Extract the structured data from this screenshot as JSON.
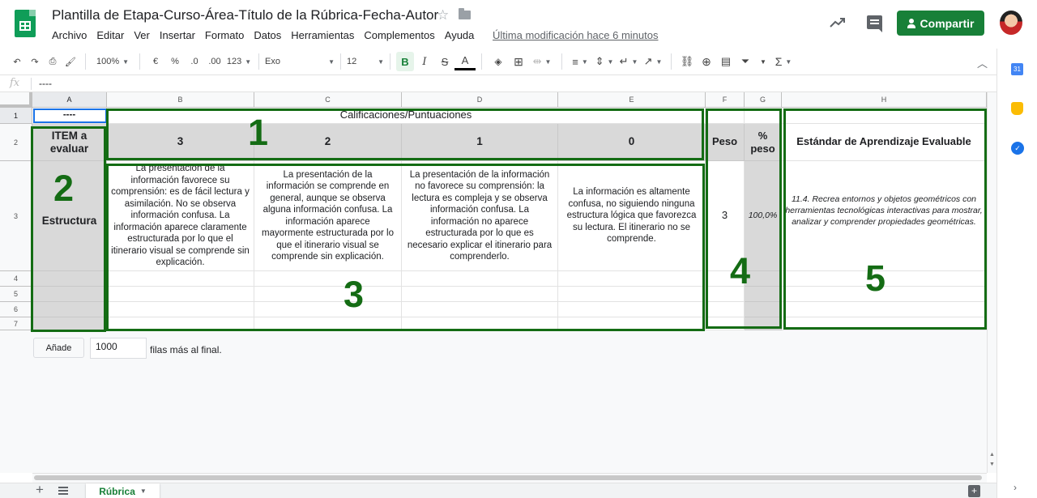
{
  "doc": {
    "title": "Plantilla de Etapa-Curso-Área-Título de la Rúbrica-Fecha-Autor",
    "last_edit": "Última modificación hace 6 minutos",
    "share_label": "Compartir"
  },
  "menu": [
    "Archivo",
    "Editar",
    "Ver",
    "Insertar",
    "Formato",
    "Datos",
    "Herramientas",
    "Complementos",
    "Ayuda"
  ],
  "toolbar": {
    "zoom": "100%",
    "currency": "€",
    "percent": "%",
    "dec_decrease": ".0",
    "dec_increase": ".00",
    "more_formats": "123",
    "font": "Exo",
    "font_size": "12",
    "bold": "B",
    "italic": "I",
    "strike": "S",
    "text_color": "A"
  },
  "formula_bar": {
    "fx": "fx",
    "value": "----"
  },
  "columns": [
    "A",
    "B",
    "C",
    "D",
    "E",
    "F",
    "G",
    "H"
  ],
  "rows": [
    "1",
    "2",
    "3",
    "4",
    "5",
    "6",
    "7"
  ],
  "cells": {
    "a1": "----",
    "header_span": "Calificaciones/Puntuaciones",
    "a2": "ITEM  a evaluar",
    "score_3": "3",
    "score_2": "2",
    "score_1": "1",
    "score_0": "0",
    "f2": "Peso",
    "g2": "% peso",
    "h2": "Estándar de Aprendizaje Evaluable",
    "a3": "Estructura",
    "b3": "La presentación de la información favorece su comprensión: es de fácil lectura y asimilación. No se observa información confusa. La información aparece claramente estructurada por lo que el itinerario visual se comprende sin explicación.",
    "c3": "La presentación de la información se comprende en general, aunque se observa alguna información confusa. La información aparece mayormente estructurada por lo que el itinerario visual se comprende sin explicación.",
    "d3": "La presentación de la información no favorece su comprensión: la lectura es compleja y se observa información confusa. La información no aparece estructurada por lo que es necesario explicar el itinerario para comprenderlo.",
    "e3": "La información es altamente confusa, no siguiendo ninguna estructura lógica que favorezca su lectura. El itinerario no se comprende.",
    "f3": "3",
    "g3": "100,0%",
    "h3": "11.4. Recrea entornos y objetos geométricos con herramientas tecnológicas interactivas para mostrar, analizar y comprender propiedades geométricas."
  },
  "annotations": [
    "1",
    "2",
    "3",
    "4",
    "5"
  ],
  "annotation_color": "#146c14",
  "add_rows": {
    "button": "Añade",
    "count": "1000",
    "suffix": "filas más al final."
  },
  "sheet_tab": "Rúbrica",
  "side_panel": {
    "calendar": "31"
  },
  "colors": {
    "accent": "#188038",
    "selection": "#1a73e8",
    "header_gray": "#d9d9d9"
  }
}
